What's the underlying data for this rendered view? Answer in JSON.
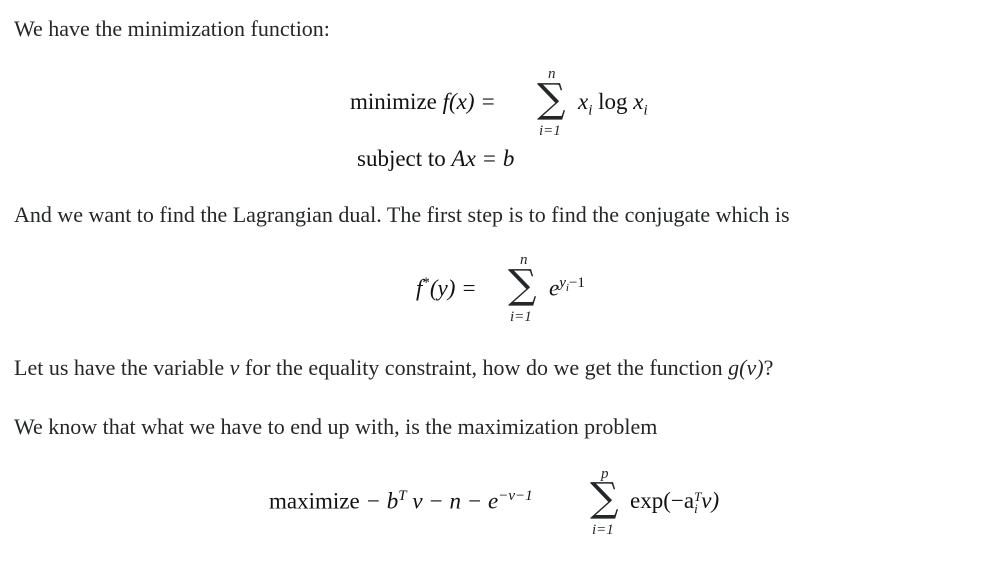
{
  "paragraphs": {
    "p1": "We have the minimization function:",
    "p2": "And we want to find the Lagrangian dual. The first step is to find the conjugate which is",
    "p3_a": "Let us have the variable ",
    "p3_var": "v",
    "p3_b": " for the equality constraint, how do we get the function ",
    "p3_fn": "g(v)",
    "p3_c": "?",
    "p4": "We know that what we have to end up with, is the maximization problem"
  },
  "eq1": {
    "label": "minimize",
    "lhs": "f(x) =",
    "sum_upper": "n",
    "sum_lower": "i=1",
    "term": "x",
    "term_sub": "i",
    "log": "log",
    "term2": "x",
    "term2_sub": "i",
    "constraint_label": "subject to",
    "constraint": "Ax = b"
  },
  "eq2": {
    "lhs": "f",
    "lhs_sup": "*",
    "lhs_arg": "(y) =",
    "sum_upper": "n",
    "sum_lower": "i=1",
    "base": "e",
    "exponent": "y",
    "exponent_sub": "i",
    "exponent_tail": "−1"
  },
  "eq3": {
    "label": "maximize",
    "part1": "− b",
    "part1_sup": "T",
    "part2": "v − n − e",
    "part2_sup": "−v−1",
    "sum_upper": "p",
    "sum_lower": "i=1",
    "exp": "exp(−a",
    "a_sub": "i",
    "a_sup": "T",
    "tail": "v)"
  }
}
